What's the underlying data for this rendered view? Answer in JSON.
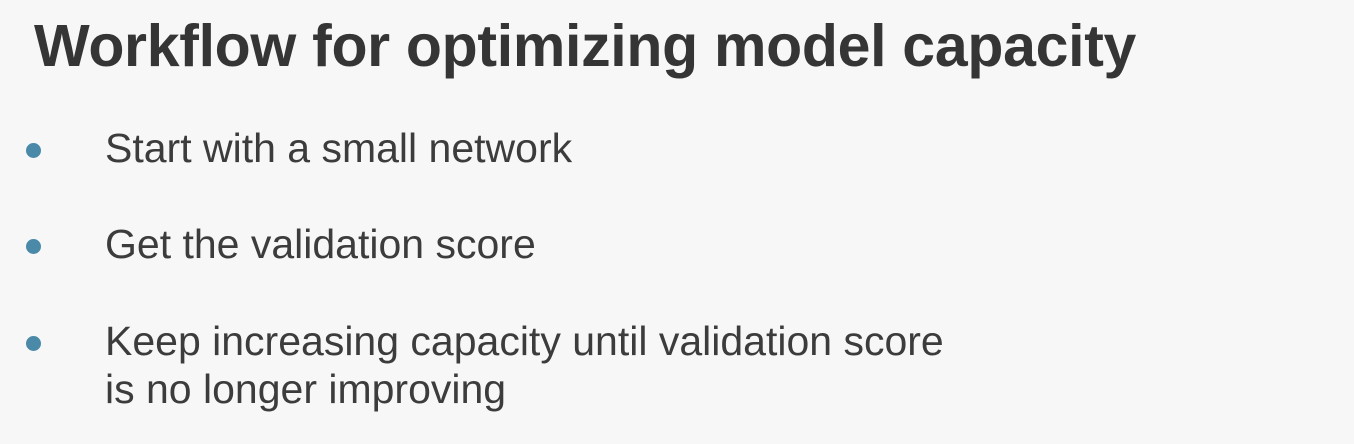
{
  "slide": {
    "title": "Workflow for optimizing model capacity",
    "bullet_color": "#4a8aa8",
    "bullets": [
      {
        "line1": "Start with a small network",
        "line2": ""
      },
      {
        "line1": "Get the validation score",
        "line2": ""
      },
      {
        "line1": "Keep increasing capacity until validation score",
        "line2": "is no longer improving"
      }
    ]
  }
}
